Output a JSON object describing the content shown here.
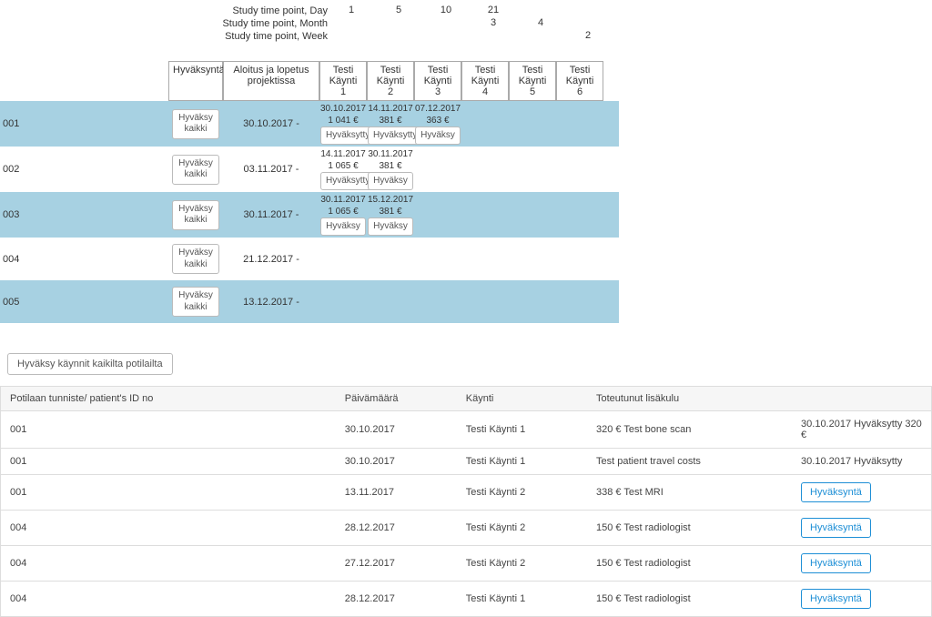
{
  "time_points": {
    "rows": [
      {
        "label": "Study time point, Day",
        "values": [
          "1",
          "5",
          "10",
          "21",
          "",
          ""
        ]
      },
      {
        "label": "Study time point, Month",
        "values": [
          "",
          "",
          "",
          "3",
          "4",
          ""
        ]
      },
      {
        "label": "Study time point, Week",
        "values": [
          "",
          "",
          "",
          "",
          "",
          "2"
        ]
      }
    ]
  },
  "schedule": {
    "headers": {
      "approval": "Hyväksyntä",
      "start_end": "Aloitus ja lopetus projektissa",
      "visits": [
        {
          "line1": "Testi Käynti",
          "line2": "1"
        },
        {
          "line1": "Testi Käynti",
          "line2": "2"
        },
        {
          "line1": "Testi Käynti",
          "line2": "3"
        },
        {
          "line1": "Testi Käynti",
          "line2": "4"
        },
        {
          "line1": "Testi Käynti",
          "line2": "5"
        },
        {
          "line1": "Testi Käynti",
          "line2": "6"
        }
      ]
    },
    "approve_all_label": "Hyväksy kaikki",
    "rows": [
      {
        "id": "001",
        "start": "30.10.2017 -",
        "visits": [
          {
            "date": "30.10.2017",
            "cost": "1 041 €",
            "btn": "Hyväksytty"
          },
          {
            "date": "14.11.2017",
            "cost": "381 €",
            "btn": "Hyväksytty"
          },
          {
            "date": "07.12.2017",
            "cost": "363 €",
            "btn": "Hyväksy"
          }
        ]
      },
      {
        "id": "002",
        "start": "03.11.2017 -",
        "visits": [
          {
            "date": "14.11.2017",
            "cost": "1 065 €",
            "btn": "Hyväksytty"
          },
          {
            "date": "30.11.2017",
            "cost": "381 €",
            "btn": "Hyväksy"
          }
        ]
      },
      {
        "id": "003",
        "start": "30.11.2017 -",
        "visits": [
          {
            "date": "30.11.2017",
            "cost": "1 065 €",
            "btn": "Hyväksy"
          },
          {
            "date": "15.12.2017",
            "cost": "381 €",
            "btn": "Hyväksy"
          }
        ]
      },
      {
        "id": "004",
        "start": "21.12.2017 -",
        "visits": []
      },
      {
        "id": "005",
        "start": "13.12.2017 -",
        "visits": []
      }
    ]
  },
  "approve_all_patients_btn": "Hyväksy käynnit kaikilta potilailta",
  "cost_table": {
    "headers": {
      "id": "Potilaan tunniste/ patient's ID no",
      "date": "Päivämäärä",
      "visit": "Käynti",
      "cost": "Toteutunut lisäkulu",
      "action": ""
    },
    "approve_btn": "Hyväksyntä",
    "rows": [
      {
        "id": "001",
        "date": "30.10.2017",
        "visit": "Testi Käynti 1",
        "cost": "320 € Test bone scan",
        "action_text": "30.10.2017 Hyväksytty 320 €",
        "approved": true
      },
      {
        "id": "001",
        "date": "30.10.2017",
        "visit": "Testi Käynti 1",
        "cost": "Test patient travel costs",
        "action_text": "30.10.2017 Hyväksytty",
        "approved": true
      },
      {
        "id": "001",
        "date": "13.11.2017",
        "visit": "Testi Käynti 2",
        "cost": "338 € Test MRI",
        "approved": false
      },
      {
        "id": "004",
        "date": "28.12.2017",
        "visit": "Testi Käynti 2",
        "cost": "150 € Test radiologist",
        "approved": false
      },
      {
        "id": "004",
        "date": "27.12.2017",
        "visit": "Testi Käynti 2",
        "cost": "150 € Test radiologist",
        "approved": false
      },
      {
        "id": "004",
        "date": "28.12.2017",
        "visit": "Testi Käynti 1",
        "cost": "150 € Test radiologist",
        "approved": false
      }
    ]
  }
}
